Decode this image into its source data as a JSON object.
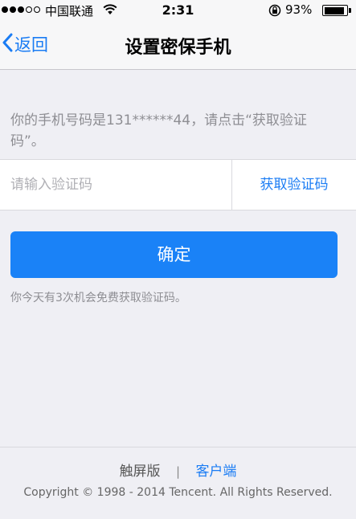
{
  "status_bar": {
    "carrier": "中国联通",
    "time": "2:31",
    "battery_percent": "93%",
    "battery_level": 0.93,
    "signal_bars_filled": 3,
    "signal_bars_total": 5,
    "icons": [
      "signal-dots-icon",
      "wifi-icon",
      "rotation-lock-icon",
      "battery-icon"
    ]
  },
  "nav": {
    "back_label": "返回",
    "title": "设置密保手机",
    "back_icon": "chevron-left-icon"
  },
  "form": {
    "instruction": "你的手机号码是131******44，请点击“获取验证码”。",
    "code_placeholder": "请输入验证码",
    "code_value": "",
    "get_code_label": "获取验证码",
    "confirm_label": "确定",
    "hint": "你今天有3次机会免费获取验证码。"
  },
  "footer": {
    "link_touch": "触屏版",
    "separator": "|",
    "link_client": "客户端",
    "copyright": "Copyright © 1998 - 2014 Tencent. All Rights Reserved."
  },
  "colors": {
    "accent": "#1a7cf4",
    "button": "#1a82f7",
    "background": "#efeff4",
    "secondary_text": "#8e8e93"
  }
}
